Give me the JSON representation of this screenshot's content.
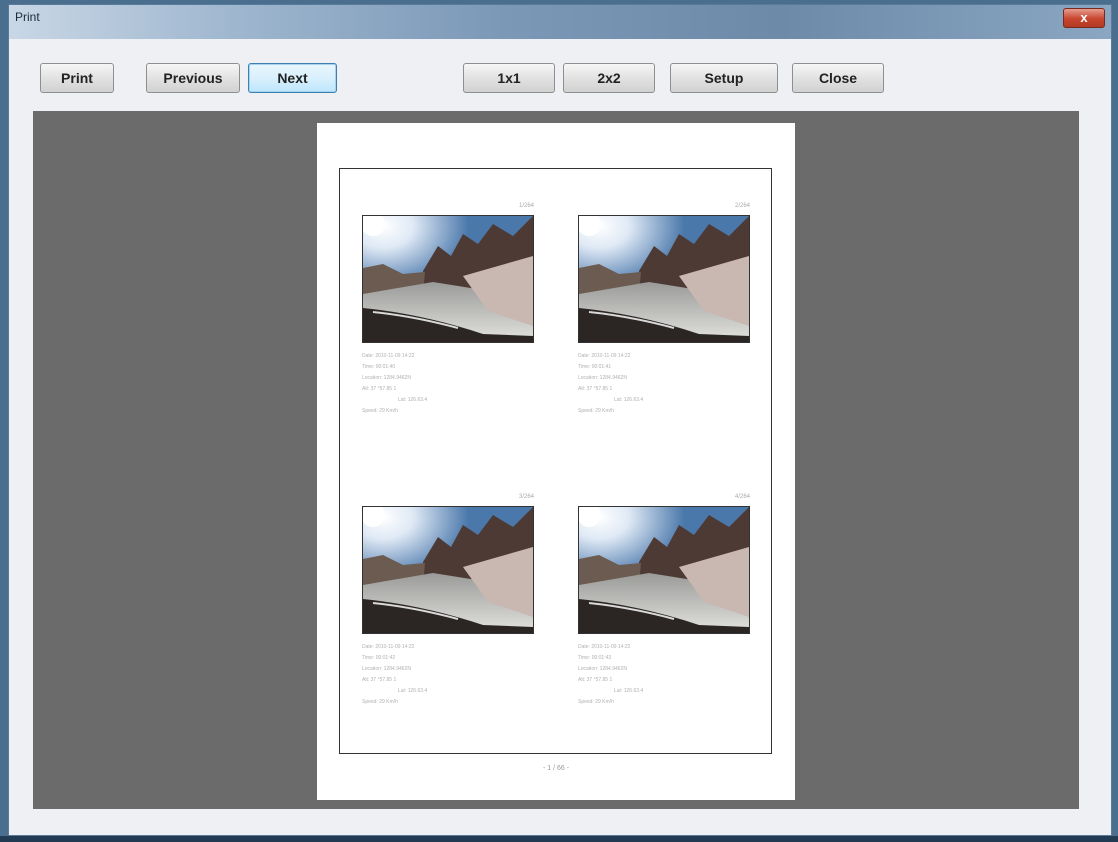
{
  "window": {
    "title": "Print",
    "close_glyph": "x"
  },
  "toolbar": {
    "print": "Print",
    "previous": "Previous",
    "next": "Next",
    "layout_1x1": "1x1",
    "layout_2x2": "2x2",
    "setup": "Setup",
    "close": "Close"
  },
  "preview": {
    "page_number": "- 1 / 66 -",
    "cells": [
      {
        "number": "1/264",
        "info": [
          "Date: 2010-11-09 14:22",
          "Time: 00:01:40",
          "Location: 1284.9462N",
          "Alt: 37 °57.85 1",
          "Lat: 126.63.4",
          "Speed: 29 Km/h"
        ]
      },
      {
        "number": "2/264",
        "info": [
          "Date: 2010-11-09 14:22",
          "Time: 00:01:41",
          "Location: 1284.9462N",
          "Alt: 37 °57.85 1",
          "Lat: 126.63.4",
          "Speed: 29 Km/h"
        ]
      },
      {
        "number": "3/264",
        "info": [
          "Date: 2010-11-09 14:22",
          "Time: 00:01:42",
          "Location: 1284.9462N",
          "Alt: 37 °57.85 1",
          "Lat: 126.63.4",
          "Speed: 29 Km/h"
        ]
      },
      {
        "number": "4/264",
        "info": [
          "Date: 2010-11-09 14:22",
          "Time: 00:01:43",
          "Location: 1284.9462N",
          "Alt: 37 °57.85 1",
          "Lat: 126.63.4",
          "Speed: 29 Km/h"
        ]
      }
    ]
  },
  "colors": {
    "viewport_bg": "#6b6b6b",
    "toolbar_bg": "#eef0f3",
    "close_button": "#c7452f"
  }
}
